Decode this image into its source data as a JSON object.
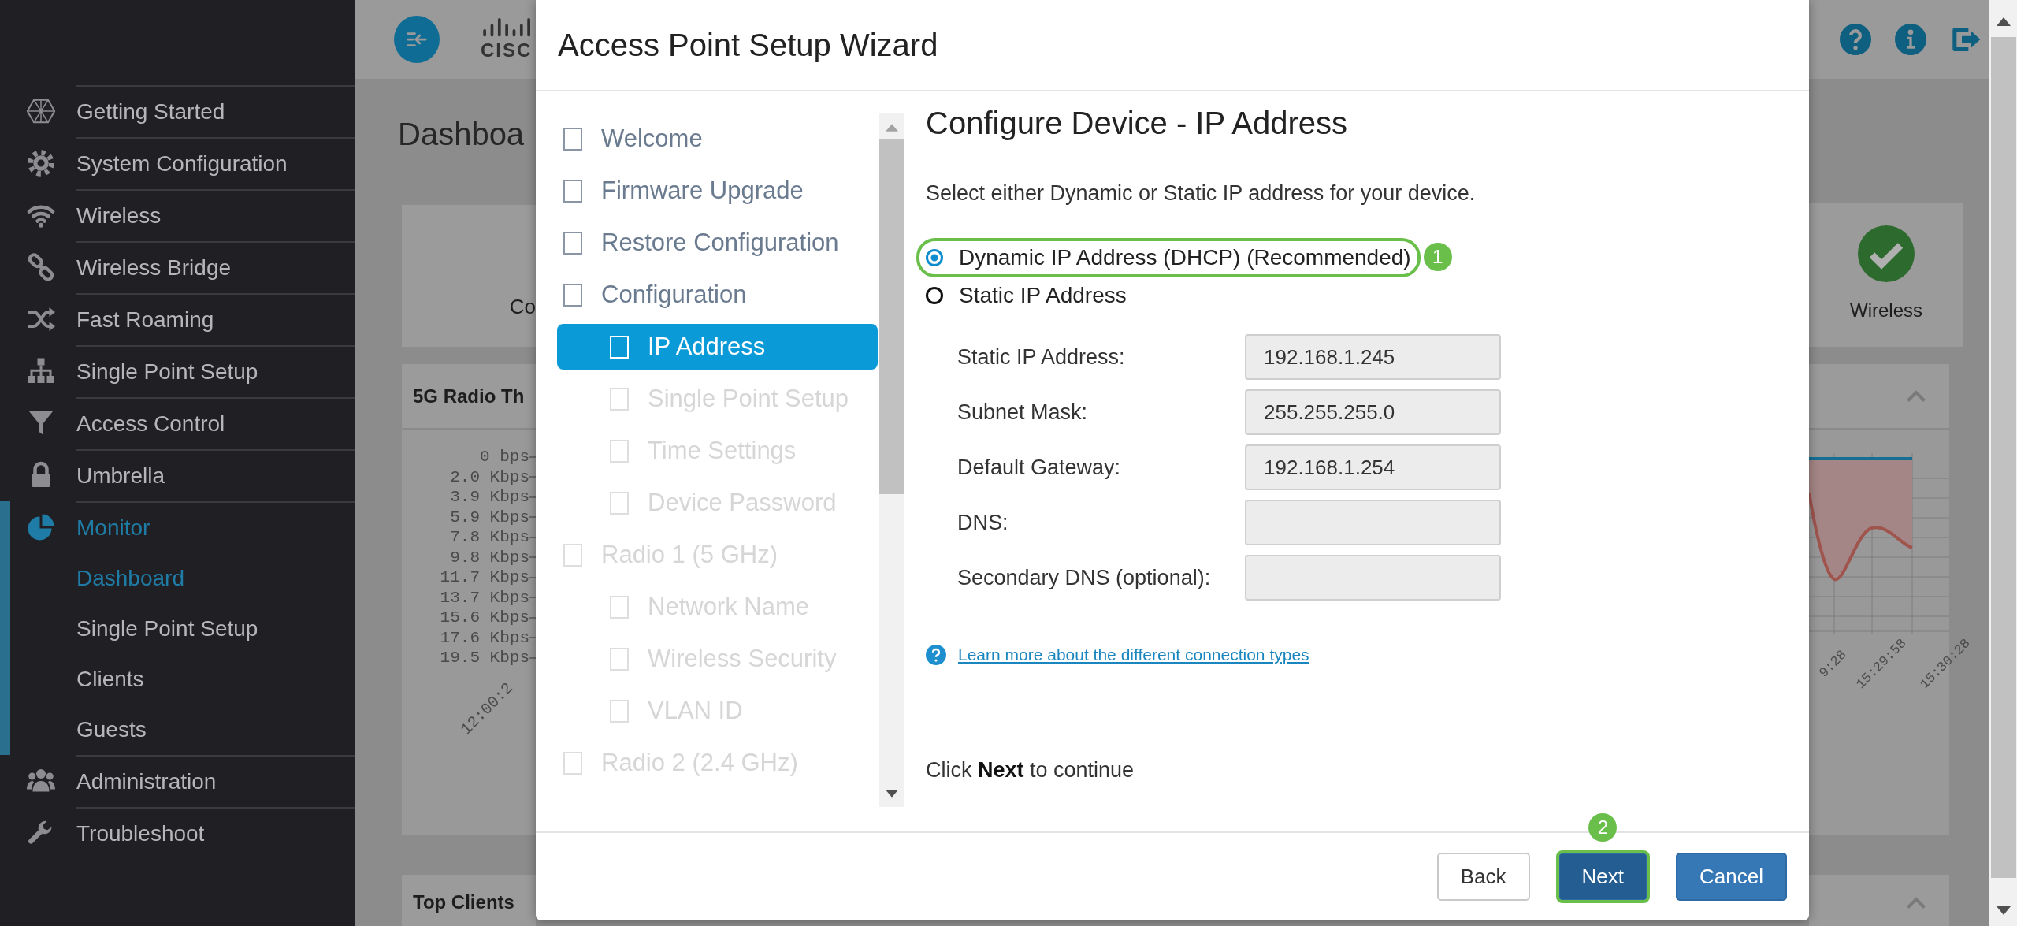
{
  "sidebar": {
    "items": [
      {
        "label": "Getting Started",
        "selected": false
      },
      {
        "label": "System Configuration",
        "selected": false
      },
      {
        "label": "Wireless",
        "selected": false
      },
      {
        "label": "Wireless Bridge",
        "selected": false
      },
      {
        "label": "Fast Roaming",
        "selected": false
      },
      {
        "label": "Single Point Setup",
        "selected": false
      },
      {
        "label": "Access Control",
        "selected": false
      },
      {
        "label": "Umbrella",
        "selected": false
      },
      {
        "label": "Monitor",
        "selected": true,
        "expanded": true,
        "children": [
          {
            "label": "Dashboard",
            "selected": true
          },
          {
            "label": "Single Point Setup",
            "selected": false
          },
          {
            "label": "Clients",
            "selected": false
          },
          {
            "label": "Guests",
            "selected": false
          }
        ]
      },
      {
        "label": "Administration",
        "selected": false
      },
      {
        "label": "Troubleshoot",
        "selected": false
      }
    ]
  },
  "header": {
    "logo_text": "CISC"
  },
  "background": {
    "page_title": "Dashboa",
    "status_cards": [
      {
        "label": "Co"
      },
      {
        "label": "Wireless",
        "ok": true
      }
    ],
    "chart_panel": {
      "title": "5G Radio Th",
      "y_labels": [
        "0 bps",
        "2.0 Kbps",
        "3.9 Kbps",
        "5.9 Kbps",
        "7.8 Kbps",
        "9.8 Kbps",
        "11.7 Kbps",
        "13.7 Kbps",
        "15.6 Kbps",
        "17.6 Kbps",
        "19.5 Kbps"
      ],
      "x_labels_left": [
        "12:00:2"
      ],
      "x_labels_right": [
        "9:28",
        "15:29:58",
        "15:30:28"
      ]
    },
    "bottom_panel": {
      "title": "Top Clients"
    }
  },
  "wizard": {
    "title": "Access Point Setup Wizard",
    "steps": [
      {
        "label": "Welcome",
        "selected": false,
        "disabled": false
      },
      {
        "label": "Firmware Upgrade",
        "selected": false,
        "disabled": false
      },
      {
        "label": "Restore Configuration",
        "selected": false,
        "disabled": false
      },
      {
        "label": "Configuration",
        "selected": false,
        "disabled": false,
        "children": [
          {
            "label": "IP Address",
            "selected": true,
            "disabled": false
          },
          {
            "label": "Single Point Setup",
            "selected": false,
            "disabled": true
          },
          {
            "label": "Time Settings",
            "selected": false,
            "disabled": true
          },
          {
            "label": "Device Password",
            "selected": false,
            "disabled": true
          }
        ]
      },
      {
        "label": "Radio 1 (5 GHz)",
        "selected": false,
        "disabled": true,
        "children": [
          {
            "label": "Network Name",
            "selected": false,
            "disabled": true
          },
          {
            "label": "Wireless Security",
            "selected": false,
            "disabled": true
          },
          {
            "label": "VLAN ID",
            "selected": false,
            "disabled": true
          }
        ]
      },
      {
        "label": "Radio 2 (2.4 GHz)",
        "selected": false,
        "disabled": true
      }
    ],
    "content": {
      "title": "Configure Device - IP Address",
      "description": "Select either Dynamic or Static IP address for your device.",
      "options": [
        {
          "label": "Dynamic IP Address (DHCP) (Recommended)",
          "selected": true,
          "highlighted": true,
          "badge": "1"
        },
        {
          "label": "Static IP Address",
          "selected": false,
          "highlighted": false
        }
      ],
      "fields": [
        {
          "label": "Static IP Address:",
          "value": "192.168.1.245",
          "disabled": true
        },
        {
          "label": "Subnet Mask:",
          "value": "255.255.255.0",
          "disabled": true
        },
        {
          "label": "Default Gateway:",
          "value": "192.168.1.254",
          "disabled": true
        },
        {
          "label": "DNS:",
          "disabled": true
        },
        {
          "label": "Secondary DNS (optional):",
          "disabled": true
        }
      ],
      "help_link": "Learn more about the different connection types",
      "continue_note": "Click **Next** to continue"
    },
    "buttons": [
      {
        "label": "Back",
        "kind": "default",
        "highlighted": false
      },
      {
        "label": "Next",
        "kind": "primary",
        "highlighted": true,
        "badge": "2"
      },
      {
        "label": "Cancel",
        "kind": "primary",
        "highlighted": false
      }
    ]
  }
}
